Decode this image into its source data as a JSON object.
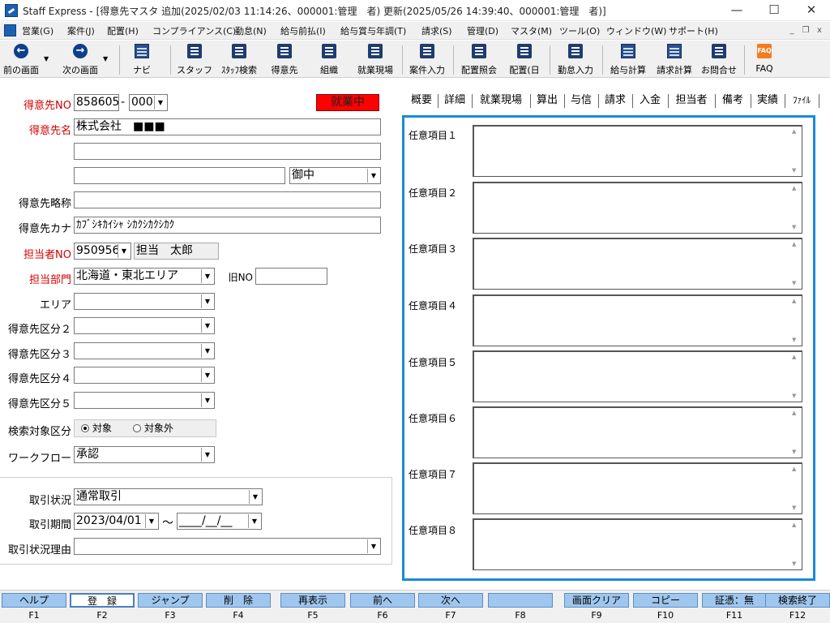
{
  "window": {
    "title": "Staff Express - [得意先マスタ 追加(2025/02/03 11:14:26、000001:管理　者) 更新(2025/05/26 14:39:40、000001:管理　者)]",
    "minimize": "—",
    "maximize": "☐",
    "close": "✕"
  },
  "menu": {
    "items": [
      "営業(G)",
      "案件(J)",
      "配置(H)",
      "コンプライアンス(C)",
      "勤怠(N)",
      "給与前払(I)",
      "給与賞与年調(T)",
      "請求(S)",
      "管理(D)",
      "マスタ(M)",
      "ツール(O)",
      "ウィンドウ(W)",
      "サポート(H)"
    ],
    "mdi": [
      "_",
      "❐",
      "x"
    ]
  },
  "toolbar": {
    "prev": "前の画面",
    "next": "次の画面",
    "navi": "ナビ",
    "staff": "スタッフ",
    "staff_search": "ｽﾀｯﾌ検索",
    "customer": "得意先",
    "org": "組織",
    "site": "就業現場",
    "case_input": "案件入力",
    "assign_inquiry": "配置照会",
    "assign_day": "配置(日",
    "attendance": "勤怠入力",
    "salary_calc": "給与計算",
    "billing_calc": "請求計算",
    "contact": "お問合せ",
    "faq": "FAQ",
    "faq_icon": "FAQ"
  },
  "form": {
    "customer_no_label": "得意先NO",
    "customer_no": "858605",
    "customer_no_sep": "-",
    "branch_no": "000",
    "status": "就業中",
    "name_label": "得意先名",
    "name1": "株式会社　■■■",
    "name2": "",
    "name3": "",
    "honorific": "御中",
    "short_label": "得意先略称",
    "short_name": "",
    "kana_label": "得意先カナ",
    "kana": "ｶﾌﾞｼｷｶｲｼｬ ｼｶｸｼｶｸｼｶｸ",
    "person_no_label": "担当者NO",
    "person_no": "950956",
    "person_name": "担当　太郎",
    "dept_label": "担当部門",
    "dept": "北海道・東北エリア",
    "old_no_label": "旧NO",
    "old_no": "",
    "area_label": "エリア",
    "area": "",
    "class2_label": "得意先区分２",
    "class2": "",
    "class3_label": "得意先区分３",
    "class3": "",
    "class4_label": "得意先区分４",
    "class4": "",
    "class5_label": "得意先区分５",
    "class5": "",
    "search_label": "検索対象区分",
    "search_on": "対象",
    "search_off": "対象外",
    "workflow_label": "ワークフロー",
    "workflow": "承認",
    "trade_status_label": "取引状況",
    "trade_status": "通常取引",
    "trade_period_label": "取引期間",
    "trade_from": "2023/04/01",
    "trade_tilde": "～",
    "trade_to": "____/__/__",
    "trade_reason_label": "取引状況理由",
    "trade_reason": ""
  },
  "tabs": [
    "概要",
    "詳細",
    "就業現場",
    "算出",
    "与信",
    "請求",
    "入金",
    "担当者",
    "備考",
    "実績",
    "ﾌｧｲﾙ"
  ],
  "active_tab": "備考",
  "memos": [
    "任意項目１",
    "任意項目２",
    "任意項目３",
    "任意項目４",
    "任意項目５",
    "任意項目６",
    "任意項目７",
    "任意項目８"
  ],
  "scroll_up": "▲",
  "scroll_down": "▼",
  "dropdown_arrow": "▼",
  "fkeys": [
    {
      "label": "ヘルプ",
      "key": "F1"
    },
    {
      "label": "登　録",
      "key": "F2"
    },
    {
      "label": "ジャンプ",
      "key": "F3"
    },
    {
      "label": "削　除",
      "key": "F4"
    },
    {
      "label": "再表示",
      "key": "F5"
    },
    {
      "label": "前へ",
      "key": "F6"
    },
    {
      "label": "次へ",
      "key": "F7"
    },
    {
      "label": "",
      "key": "F8"
    },
    {
      "label": "画面クリア",
      "key": "F9"
    },
    {
      "label": "コピー",
      "key": "F10"
    },
    {
      "label": "証憑：無",
      "key": "F11"
    },
    {
      "label": "検索終了",
      "key": "F12"
    }
  ]
}
